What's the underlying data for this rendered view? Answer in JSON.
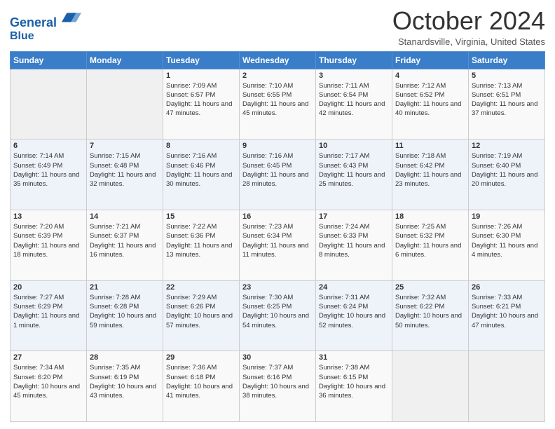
{
  "header": {
    "logo_line1": "General",
    "logo_line2": "Blue",
    "month": "October 2024",
    "location": "Stanardsville, Virginia, United States"
  },
  "weekdays": [
    "Sunday",
    "Monday",
    "Tuesday",
    "Wednesday",
    "Thursday",
    "Friday",
    "Saturday"
  ],
  "weeks": [
    [
      {
        "day": "",
        "info": ""
      },
      {
        "day": "",
        "info": ""
      },
      {
        "day": "1",
        "info": "Sunrise: 7:09 AM\nSunset: 6:57 PM\nDaylight: 11 hours and 47 minutes."
      },
      {
        "day": "2",
        "info": "Sunrise: 7:10 AM\nSunset: 6:55 PM\nDaylight: 11 hours and 45 minutes."
      },
      {
        "day": "3",
        "info": "Sunrise: 7:11 AM\nSunset: 6:54 PM\nDaylight: 11 hours and 42 minutes."
      },
      {
        "day": "4",
        "info": "Sunrise: 7:12 AM\nSunset: 6:52 PM\nDaylight: 11 hours and 40 minutes."
      },
      {
        "day": "5",
        "info": "Sunrise: 7:13 AM\nSunset: 6:51 PM\nDaylight: 11 hours and 37 minutes."
      }
    ],
    [
      {
        "day": "6",
        "info": "Sunrise: 7:14 AM\nSunset: 6:49 PM\nDaylight: 11 hours and 35 minutes."
      },
      {
        "day": "7",
        "info": "Sunrise: 7:15 AM\nSunset: 6:48 PM\nDaylight: 11 hours and 32 minutes."
      },
      {
        "day": "8",
        "info": "Sunrise: 7:16 AM\nSunset: 6:46 PM\nDaylight: 11 hours and 30 minutes."
      },
      {
        "day": "9",
        "info": "Sunrise: 7:16 AM\nSunset: 6:45 PM\nDaylight: 11 hours and 28 minutes."
      },
      {
        "day": "10",
        "info": "Sunrise: 7:17 AM\nSunset: 6:43 PM\nDaylight: 11 hours and 25 minutes."
      },
      {
        "day": "11",
        "info": "Sunrise: 7:18 AM\nSunset: 6:42 PM\nDaylight: 11 hours and 23 minutes."
      },
      {
        "day": "12",
        "info": "Sunrise: 7:19 AM\nSunset: 6:40 PM\nDaylight: 11 hours and 20 minutes."
      }
    ],
    [
      {
        "day": "13",
        "info": "Sunrise: 7:20 AM\nSunset: 6:39 PM\nDaylight: 11 hours and 18 minutes."
      },
      {
        "day": "14",
        "info": "Sunrise: 7:21 AM\nSunset: 6:37 PM\nDaylight: 11 hours and 16 minutes."
      },
      {
        "day": "15",
        "info": "Sunrise: 7:22 AM\nSunset: 6:36 PM\nDaylight: 11 hours and 13 minutes."
      },
      {
        "day": "16",
        "info": "Sunrise: 7:23 AM\nSunset: 6:34 PM\nDaylight: 11 hours and 11 minutes."
      },
      {
        "day": "17",
        "info": "Sunrise: 7:24 AM\nSunset: 6:33 PM\nDaylight: 11 hours and 8 minutes."
      },
      {
        "day": "18",
        "info": "Sunrise: 7:25 AM\nSunset: 6:32 PM\nDaylight: 11 hours and 6 minutes."
      },
      {
        "day": "19",
        "info": "Sunrise: 7:26 AM\nSunset: 6:30 PM\nDaylight: 11 hours and 4 minutes."
      }
    ],
    [
      {
        "day": "20",
        "info": "Sunrise: 7:27 AM\nSunset: 6:29 PM\nDaylight: 11 hours and 1 minute."
      },
      {
        "day": "21",
        "info": "Sunrise: 7:28 AM\nSunset: 6:28 PM\nDaylight: 10 hours and 59 minutes."
      },
      {
        "day": "22",
        "info": "Sunrise: 7:29 AM\nSunset: 6:26 PM\nDaylight: 10 hours and 57 minutes."
      },
      {
        "day": "23",
        "info": "Sunrise: 7:30 AM\nSunset: 6:25 PM\nDaylight: 10 hours and 54 minutes."
      },
      {
        "day": "24",
        "info": "Sunrise: 7:31 AM\nSunset: 6:24 PM\nDaylight: 10 hours and 52 minutes."
      },
      {
        "day": "25",
        "info": "Sunrise: 7:32 AM\nSunset: 6:22 PM\nDaylight: 10 hours and 50 minutes."
      },
      {
        "day": "26",
        "info": "Sunrise: 7:33 AM\nSunset: 6:21 PM\nDaylight: 10 hours and 47 minutes."
      }
    ],
    [
      {
        "day": "27",
        "info": "Sunrise: 7:34 AM\nSunset: 6:20 PM\nDaylight: 10 hours and 45 minutes."
      },
      {
        "day": "28",
        "info": "Sunrise: 7:35 AM\nSunset: 6:19 PM\nDaylight: 10 hours and 43 minutes."
      },
      {
        "day": "29",
        "info": "Sunrise: 7:36 AM\nSunset: 6:18 PM\nDaylight: 10 hours and 41 minutes."
      },
      {
        "day": "30",
        "info": "Sunrise: 7:37 AM\nSunset: 6:16 PM\nDaylight: 10 hours and 38 minutes."
      },
      {
        "day": "31",
        "info": "Sunrise: 7:38 AM\nSunset: 6:15 PM\nDaylight: 10 hours and 36 minutes."
      },
      {
        "day": "",
        "info": ""
      },
      {
        "day": "",
        "info": ""
      }
    ]
  ]
}
